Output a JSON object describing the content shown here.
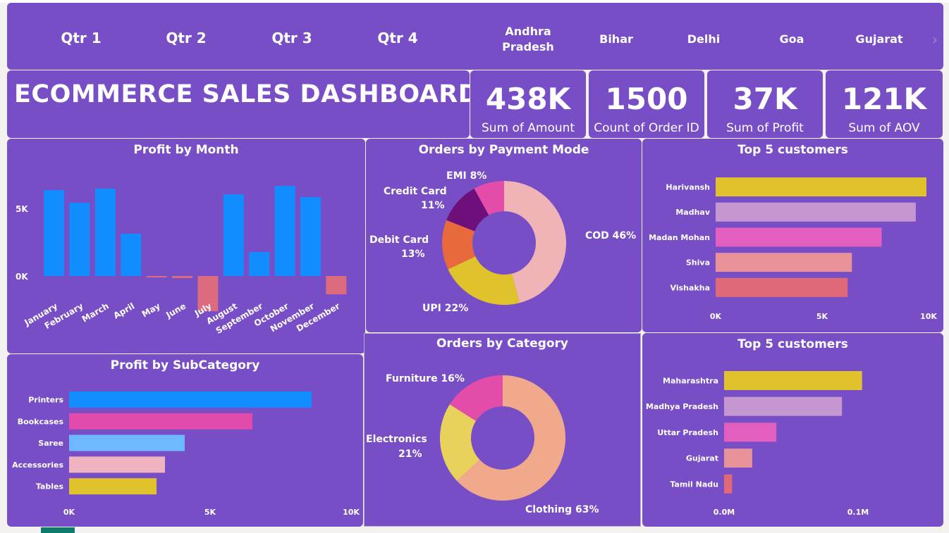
{
  "slicers": {
    "quarters": [
      "Qtr 1",
      "Qtr 2",
      "Qtr 3",
      "Qtr 4"
    ],
    "states": [
      "Andhra Pradesh",
      "Bihar",
      "Delhi",
      "Goa",
      "Gujarat"
    ]
  },
  "header": {
    "title": "ECOMMERCE SALES DASHBOARD"
  },
  "kpis": [
    {
      "value": "438K",
      "label": "Sum of Amount"
    },
    {
      "value": "1500",
      "label": "Count of Order ID"
    },
    {
      "value": "37K",
      "label": "Sum of Profit"
    },
    {
      "value": "121K",
      "label": "Sum of AOV"
    }
  ],
  "colors": {
    "panel": "#774ec5",
    "blue": "#118dff",
    "red": "#dd6b7f"
  },
  "chart_data": [
    {
      "type": "bar",
      "title": "Profit by Month",
      "categories": [
        "January",
        "February",
        "March",
        "April",
        "May",
        "June",
        "July",
        "August",
        "September",
        "October",
        "November",
        "December"
      ],
      "values": [
        6100,
        5200,
        6200,
        3000,
        -100,
        -150,
        -2500,
        5800,
        1700,
        6400,
        5600,
        -1300
      ],
      "yticks": [
        "5K",
        "0K"
      ],
      "ylim": [
        -3000,
        8000
      ]
    },
    {
      "type": "pie",
      "title": "Orders by Payment Mode",
      "labels": [
        "COD",
        "UPI",
        "Debit Card",
        "Credit Card",
        "EMI"
      ],
      "values": [
        46,
        22,
        13,
        11,
        8
      ],
      "label_text": [
        "COD 46%",
        "UPI 22%",
        "Debit Card",
        "13%",
        "Credit Card",
        "11%",
        "EMI 8%"
      ],
      "colors": [
        "#f0b4b7",
        "#e0c22c",
        "#e8693b",
        "#6f0f7c",
        "#e34da9"
      ]
    },
    {
      "type": "bar",
      "title": "Top 5 customers",
      "categories": [
        "Harivansh",
        "Madhav",
        "Madan Mohan",
        "Shiva",
        "Vishakha"
      ],
      "values": [
        9900,
        9400,
        7800,
        6400,
        6200
      ],
      "xticks": [
        "0K",
        "5K",
        "10K"
      ],
      "xlim": [
        0,
        10000
      ],
      "colors": [
        "#e0c22c",
        "#c596cf",
        "#e35fbf",
        "#e8929a",
        "#df6976"
      ]
    },
    {
      "type": "bar",
      "title": "Profit by SubCategory",
      "categories": [
        "Printers",
        "Bookcases",
        "Saree",
        "Accessories",
        "Tables"
      ],
      "values": [
        8600,
        6500,
        4100,
        3400,
        3100
      ],
      "xticks": [
        "0K",
        "5K",
        "10K"
      ],
      "xlim": [
        0,
        10000
      ],
      "colors": [
        "#118dff",
        "#e24aac",
        "#6db8ff",
        "#f0b4c0",
        "#e0c22c"
      ]
    },
    {
      "type": "pie",
      "title": "Orders by Category",
      "labels": [
        "Clothing",
        "Electronics",
        "Furniture"
      ],
      "values": [
        63,
        21,
        16
      ],
      "label_text": [
        "Clothing 63%",
        "Electronics",
        "21%",
        "Furniture 16%"
      ],
      "colors": [
        "#f1a98c",
        "#e8d25c",
        "#e34da9"
      ]
    },
    {
      "type": "bar",
      "title": "Top 5 customers",
      "categories": [
        "Maharashtra",
        "Madhya Pradesh",
        "Uttar Pradesh",
        "Gujarat",
        "Tamil Nadu"
      ],
      "values": [
        0.103,
        0.088,
        0.039,
        0.021,
        0.006
      ],
      "xticks": [
        "0.0M",
        "0.1M"
      ],
      "xlim": [
        0,
        0.1
      ],
      "colors": [
        "#e0c22c",
        "#c596cf",
        "#e35fbf",
        "#e8929a",
        "#df6976"
      ]
    }
  ]
}
